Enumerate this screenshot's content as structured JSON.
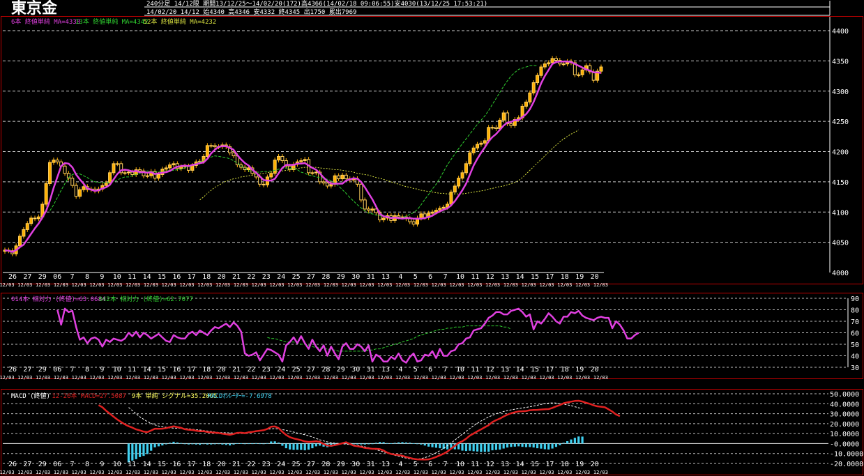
{
  "title": "東京金",
  "header": {
    "line1": "240分足  14/12限  期間13/12/25～14/02/20(172)高4366(14/02/18 09:06:55)安4030(13/12/25 17:53:21)",
    "line2": "14/02/20 14/12 始4340 高4346 安4332 終4345 出1750 累出7969"
  },
  "colors": {
    "background": "#000000",
    "frame": "#c00000",
    "grid": "#ffffff",
    "candle_up": "#ffb000",
    "candle_down": "#ffd060",
    "ma_short": "#e040e0",
    "ma_mid": "#30d030",
    "ma_long": "#d8e040",
    "rsi_short": "#e040e0",
    "rsi_long": "#30d030",
    "macd": "#e02020",
    "signal": "#ffffff",
    "osc": "#40d0f0"
  },
  "legend": {
    "price": [
      {
        "text": "6本 終値単純 MA=4338",
        "color": "#e040e0"
      },
      {
        "text": "13本 終値単純 MA=4342",
        "color": "#30d030"
      },
      {
        "text": "52本 終値単純 MA=4232",
        "color": "#d8e040"
      }
    ],
    "rsi": [
      {
        "text": "014本 相対力 (終値)=63.0684",
        "color": "#e040e0"
      },
      {
        "text": "042本 相対力 (終値)=62.7077",
        "color": "#30d030"
      }
    ],
    "macd": [
      {
        "text": "MACD (終値)",
        "color": "#ffffff"
      },
      {
        "text": "12-26本 MACD=27.5087",
        "color": "#e02020"
      },
      {
        "text": "9本 単純 シグナル=35.2065",
        "color": "#ffff60"
      },
      {
        "text": "MACDｵｼﾚｰﾀｰ=-7.6978",
        "color": "#40d0f0"
      }
    ]
  },
  "x_labels": [
    "26",
    "27",
    "29",
    "06",
    "7",
    "8",
    "9",
    "10",
    "11",
    "14",
    "15",
    "16",
    "17",
    "18",
    "20",
    "21",
    "22",
    "23",
    "24",
    "25",
    "27",
    "28",
    "29",
    "30",
    "31",
    "13",
    "4",
    "5",
    "6",
    "7",
    "10",
    "11",
    "12",
    "13",
    "14",
    "15",
    "17",
    "18",
    "19",
    "20"
  ],
  "x_code": "12/03",
  "chart_data": [
    {
      "type": "candlestick",
      "name": "price",
      "ylim": [
        4000,
        4420
      ],
      "yticks": [
        4000,
        4050,
        4100,
        4150,
        4200,
        4250,
        4300,
        4350,
        4400
      ],
      "close": [
        4037,
        4036,
        4031,
        4044,
        4060,
        4071,
        4081,
        4090,
        4089,
        4092,
        4113,
        4147,
        4182,
        4186,
        4183,
        4176,
        4164,
        4156,
        4144,
        4126,
        4137,
        4142,
        4137,
        4138,
        4135,
        4138,
        4144,
        4148,
        4165,
        4180,
        4180,
        4165,
        4165,
        4166,
        4162,
        4170,
        4168,
        4160,
        4160,
        4167,
        4156,
        4162,
        4171,
        4173,
        4178,
        4180,
        4172,
        4175,
        4176,
        4169,
        4177,
        4183,
        4184,
        4192,
        4210,
        4210,
        4208,
        4208,
        4211,
        4208,
        4198,
        4193,
        4178,
        4174,
        4170,
        4173,
        4164,
        4158,
        4146,
        4145,
        4158,
        4164,
        4186,
        4192,
        4185,
        4176,
        4170,
        4179,
        4183,
        4185,
        4187,
        4165,
        4165,
        4166,
        4150,
        4148,
        4143,
        4146,
        4160,
        4155,
        4161,
        4155,
        4153,
        4155,
        4146,
        4120,
        4105,
        4103,
        4105,
        4099,
        4087,
        4090,
        4094,
        4086,
        4094,
        4092,
        4092,
        4089,
        4084,
        4080,
        4090,
        4097,
        4091,
        4098,
        4100,
        4103,
        4106,
        4108,
        4113,
        4133,
        4143,
        4156,
        4165,
        4180,
        4198,
        4206,
        4212,
        4214,
        4218,
        4240,
        4240,
        4238,
        4252,
        4264,
        4246,
        4243,
        4253,
        4256,
        4275,
        4282,
        4297,
        4314,
        4326,
        4340,
        4345,
        4347,
        4354,
        4351,
        4345,
        4345,
        4349,
        4347,
        4327,
        4327,
        4335,
        4342,
        4332,
        4318,
        4333,
        4340
      ],
      "ma_short": [
        4037,
        4036,
        4034,
        4037,
        4042,
        4046,
        4055,
        4064,
        4073,
        4081,
        4091,
        4102,
        4119,
        4140,
        4158,
        4176,
        4181,
        4180,
        4174,
        4162,
        4154,
        4147,
        4139,
        4137,
        4135,
        4136,
        4139,
        4141,
        4145,
        4154,
        4163,
        4169,
        4170,
        4169,
        4167,
        4168,
        4166,
        4166,
        4165,
        4166,
        4163,
        4164,
        4165,
        4166,
        4168,
        4172,
        4175,
        4176,
        4177,
        4176,
        4178,
        4179,
        4181,
        4182,
        4188,
        4197,
        4203,
        4208,
        4209,
        4209,
        4206,
        4203,
        4194,
        4187,
        4181,
        4177,
        4170,
        4165,
        4159,
        4153,
        4152,
        4152,
        4155,
        4164,
        4173,
        4178,
        4178,
        4178,
        4180,
        4180,
        4181,
        4177,
        4173,
        4170,
        4164,
        4157,
        4151,
        4147,
        4147,
        4147,
        4147,
        4152,
        4154,
        4156,
        4155,
        4150,
        4141,
        4131,
        4121,
        4109,
        4097,
        4093,
        4092,
        4090,
        4091,
        4090,
        4089,
        4090,
        4090,
        4089,
        4089,
        4089,
        4090,
        4092,
        4094,
        4098,
        4101,
        4104,
        4106,
        4111,
        4118,
        4127,
        4136,
        4147,
        4162,
        4177,
        4188,
        4198,
        4207,
        4217,
        4224,
        4229,
        4236,
        4243,
        4248,
        4249,
        4252,
        4252,
        4257,
        4262,
        4270,
        4282,
        4297,
        4313,
        4325,
        4335,
        4345,
        4348,
        4349,
        4349,
        4349,
        4348,
        4345,
        4342,
        4339,
        4336,
        4334,
        4331,
        4331,
        4330
      ],
      "ma_mid_start": 12,
      "ma_mid": [
        4102,
        4112,
        4124,
        4136,
        4147,
        4157,
        4162,
        4164,
        4163,
        4160,
        4157,
        4153,
        4150,
        4149,
        4149,
        4148,
        4150,
        4150,
        4153,
        4156,
        4158,
        4158,
        4160,
        4162,
        4164,
        4167,
        4168,
        4167,
        4166,
        4167,
        4168,
        4168,
        4169,
        4169,
        4170,
        4171,
        4173,
        4175,
        4177,
        4180,
        4183,
        4186,
        4188,
        4191,
        4193,
        4192,
        4191,
        4190,
        4188,
        4185,
        4181,
        4177,
        4172,
        4168,
        4168,
        4166,
        4166,
        4167,
        4167,
        4168,
        4169,
        4171,
        4172,
        4173,
        4172,
        4172,
        4170,
        4166,
        4164,
        4161,
        4160,
        4158,
        4157,
        4156,
        4154,
        4152,
        4148,
        4143,
        4137,
        4131,
        4124,
        4118,
        4112,
        4107,
        4102,
        4098,
        4097,
        4095,
        4094,
        4093,
        4092,
        4092,
        4091,
        4090,
        4091,
        4093,
        4096,
        4099,
        4104,
        4112,
        4121,
        4129,
        4138,
        4146,
        4156,
        4167,
        4178,
        4187,
        4196,
        4205,
        4213,
        4221,
        4229,
        4237,
        4245,
        4252,
        4259,
        4268,
        4278,
        4288,
        4298,
        4308,
        4317,
        4325,
        4331,
        4336,
        4338,
        4340,
        4342,
        4342,
        4342
      ],
      "ma_long_start": 52,
      "ma_long": [
        4120,
        4125,
        4131,
        4136,
        4141,
        4144,
        4148,
        4151,
        4153,
        4155,
        4156,
        4158,
        4159,
        4160,
        4161,
        4162,
        4163,
        4164,
        4165,
        4166,
        4167,
        4168,
        4168,
        4169,
        4170,
        4171,
        4172,
        4173,
        4174,
        4174,
        4174,
        4174,
        4173,
        4172,
        4172,
        4171,
        4170,
        4170,
        4169,
        4168,
        4167,
        4166,
        4164,
        4163,
        4162,
        4161,
        4159,
        4157,
        4156,
        4154,
        4152,
        4150,
        4148,
        4146,
        4144,
        4142,
        4141,
        4139,
        4138,
        4136,
        4135,
        4134,
        4133,
        4132,
        4131,
        4131,
        4130,
        4130,
        4130,
        4130,
        4130,
        4131,
        4132,
        4133,
        4134,
        4135,
        4136,
        4138,
        4139,
        4141,
        4142,
        4143,
        4145,
        4147,
        4149,
        4152,
        4157,
        4163,
        4169,
        4175,
        4181,
        4187,
        4193,
        4199,
        4205,
        4211,
        4216,
        4221,
        4225,
        4229,
        4232,
        4236
      ]
    },
    {
      "type": "line",
      "name": "rsi",
      "ylim": [
        30,
        90
      ],
      "yticks": [
        30,
        40,
        50,
        60,
        70,
        80,
        90
      ],
      "rsi_short_start": 14,
      "rsi_short": [
        80,
        67,
        81,
        78,
        79,
        65,
        54,
        56,
        51,
        55,
        56,
        54,
        48,
        54,
        52,
        55,
        54,
        53,
        55,
        60,
        57,
        61,
        56,
        60,
        58,
        55,
        57,
        59,
        56,
        53,
        52,
        58,
        56,
        55,
        55,
        59,
        61,
        58,
        62,
        60,
        58,
        62,
        65,
        64,
        66,
        68,
        65,
        69,
        66,
        61,
        42,
        40,
        41,
        43,
        36,
        41,
        46,
        45,
        43,
        41,
        35,
        49,
        52,
        56,
        51,
        57,
        51,
        46,
        54,
        48,
        44,
        49,
        40,
        48,
        42,
        37,
        48,
        51,
        46,
        46,
        50,
        48,
        44,
        49,
        35,
        41,
        39,
        35,
        35,
        39,
        37,
        42,
        36,
        34,
        39,
        42,
        35,
        36,
        41,
        40,
        44,
        38,
        46,
        40,
        40,
        44,
        45,
        50,
        51,
        55,
        56,
        62,
        63,
        64,
        68,
        73,
        75,
        78,
        78,
        76,
        76,
        79,
        80,
        81,
        78,
        74,
        76,
        63,
        70,
        68,
        72,
        77,
        74,
        70,
        68,
        74,
        74,
        78,
        77,
        79,
        75,
        73,
        72,
        71,
        73,
        74,
        73,
        73,
        64,
        70,
        67,
        62,
        55,
        55,
        58,
        60
      ],
      "rsi_long_start": 70,
      "rsi_long": [
        56,
        55,
        55,
        54,
        53,
        52,
        52,
        52,
        51,
        50,
        50,
        49,
        48,
        47,
        47,
        46,
        46,
        45,
        45,
        44,
        44,
        44,
        44,
        44,
        44,
        44,
        44,
        45,
        45,
        46,
        46,
        47,
        48,
        49,
        50,
        51,
        52,
        53,
        54,
        55,
        57,
        58,
        59,
        60,
        61,
        62,
        63,
        63,
        64,
        64,
        65,
        65,
        65,
        66,
        66,
        66,
        66,
        66,
        66,
        66,
        66,
        66,
        66,
        65,
        65,
        63
      ]
    },
    {
      "type": "line+bar",
      "name": "macd",
      "ylim": [
        -20,
        50
      ],
      "yticks": [
        50,
        40,
        30,
        20,
        10,
        0,
        -10,
        -20
      ],
      "ytick_labels": [
        "50.0000",
        "40.0000",
        "30.0000",
        "20.0000",
        "10.0000",
        "-0.0000",
        "-10.0000",
        "-20.0000"
      ],
      "macd_start": 25,
      "macd": [
        38.6,
        36.5,
        32.9,
        29.9,
        27.0,
        24.1,
        21.6,
        19.3,
        17.4,
        16.0,
        14.2,
        13.2,
        12.0,
        11.5,
        13.1,
        14.9,
        14.8,
        14.9,
        15.5,
        16.5,
        17.3,
        16.5,
        15.8,
        14.4,
        13.9,
        13.6,
        12.9,
        12.4,
        12.5,
        11.6,
        11.2,
        10.9,
        10.6,
        9.9,
        9.4,
        8.8,
        9.6,
        10.7,
        10.9,
        10.4,
        11.3,
        11.7,
        12.5,
        12.9,
        13.4,
        14.7,
        16.9,
        17.2,
        15.6,
        11.8,
        8.6,
        6.4,
        5.1,
        4.3,
        3.3,
        2.1,
        1.6,
        1.9,
        2.3,
        1.6,
        -0.5,
        -2.0,
        -2.2,
        -1.6,
        -0.8,
        0.3,
        1.3,
        -0.4,
        -2.1,
        -2.7,
        -3.4,
        -4.3,
        -4.8,
        -5.3,
        -5.3,
        -5.6,
        -7.0,
        -9.2,
        -10.5,
        -11.1,
        -11.6,
        -12.3,
        -13.5,
        -14.5,
        -15.4,
        -15.9,
        -16.0,
        -16.1,
        -15.9,
        -14.9,
        -13.5,
        -11.8,
        -10.2,
        -8.1,
        -5.1,
        -2.3,
        0.7,
        2.3,
        4.8,
        7.9,
        10.1,
        12.3,
        14.2,
        16.4,
        18.4,
        21.6,
        23.5,
        25.1,
        27.2,
        29.0,
        30.4,
        31.4,
        32.3,
        32.4,
        32.7,
        33.5,
        33.7,
        33.8,
        34.2,
        34.4,
        34.6,
        35.8,
        37.3,
        38.6,
        40.5,
        41.3,
        42.1,
        42.8,
        43.0,
        42.2,
        40.8,
        39.9,
        38.4,
        37.4,
        37.0,
        36.4,
        34.3,
        32.1,
        29.2,
        27.5
      ],
      "signal_start": 33,
      "signal": [
        36.3,
        33.1,
        29.9,
        26.8,
        24.4,
        22.1,
        20.3,
        18.7,
        17.6,
        16.8,
        16.3,
        15.7,
        15.5,
        15.4,
        15.3,
        15.0,
        14.8,
        14.3,
        13.9,
        13.6,
        13.1,
        12.6,
        12.1,
        11.6,
        11.1,
        10.9,
        10.8,
        10.7,
        10.6,
        10.5,
        10.6,
        10.8,
        11.2,
        11.6,
        12.1,
        12.8,
        13.6,
        14.3,
        14.8,
        15.0,
        14.6,
        14.0,
        13.3,
        12.4,
        11.5,
        10.6,
        9.7,
        8.9,
        7.8,
        6.6,
        5.1,
        3.7,
        2.6,
        1.7,
        0.9,
        0.4,
        0.1,
        -0.2,
        -0.6,
        -1.0,
        -1.4,
        -1.9,
        -2.5,
        -3.3,
        -4.1,
        -5.1,
        -6.1,
        -7.2,
        -8.4,
        -9.6,
        -10.8,
        -11.8,
        -12.8,
        -13.7,
        -14.6,
        -15.4,
        -15.7,
        -15.6,
        -15.0,
        -14.1,
        -12.8,
        -11.2,
        -9.3,
        -7.1,
        -4.8,
        -2.2,
        0.6,
        3.5,
        6.5,
        9.4,
        12.3,
        15.1,
        17.8,
        20.3,
        22.7,
        24.8,
        26.7,
        28.4,
        29.9,
        31.2,
        32.2,
        33.0,
        33.8,
        34.5,
        35.1,
        35.7,
        36.3,
        37.0,
        37.7,
        38.5,
        39.3,
        40.1,
        40.6,
        40.8,
        40.7,
        40.3,
        39.7,
        38.9,
        38.0,
        37.0,
        35.9,
        35.2
      ]
    }
  ]
}
